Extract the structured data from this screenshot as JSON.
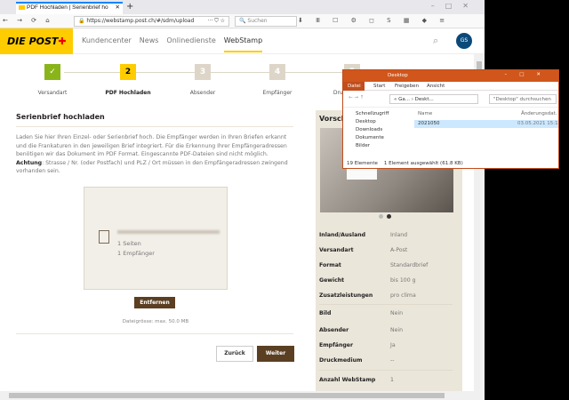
{
  "browser": {
    "tab_title": "PDF Hochladen | Serienbrief ho",
    "url": "https://webstamp.post.ch/#/sdm/upload",
    "search_placeholder": "Suchen",
    "more": "··· ⛉ ☆"
  },
  "header": {
    "logo": "DIE POST",
    "nav": [
      "Kundencenter",
      "News",
      "Onlinedienste",
      "WebStamp"
    ],
    "avatar": "GS"
  },
  "steps": [
    {
      "num": "✓",
      "label": "Versandart"
    },
    {
      "num": "2",
      "label": "PDF Hochladen"
    },
    {
      "num": "3",
      "label": "Absender"
    },
    {
      "num": "4",
      "label": "Empfänger"
    },
    {
      "num": "5",
      "label": "Druckmedium"
    },
    {
      "num": "6",
      "label": ""
    }
  ],
  "main": {
    "title": "Serienbrief hochladen",
    "desc": "Laden Sie hier Ihren Einzel- oder Serienbrief hoch. Die Empfänger werden in Ihren Briefen erkannt und die Frankaturen in den jeweiligen Brief integriert. Für die Erkennung Ihrer Empfängeradressen benötigen wir das Dokument im PDF Format. Eingescannte PDF-Dateien sind nicht möglich.",
    "warn_label": "Achtung",
    "warn_text": ": Strasse / Nr. (oder Postfach) und PLZ / Ort müssen in den Empfängeradressen zwingend vorhanden sein.",
    "pages": "1 Seiten",
    "recipients": "1 Empfänger",
    "remove": "Entfernen",
    "filesize": "Dateigrösse: max. 50.0 MB",
    "back": "Zurück",
    "next": "Weiter"
  },
  "preview": {
    "title": "Vorschau",
    "rows": [
      {
        "k": "Inland/Ausland",
        "v": "Inland"
      },
      {
        "k": "Versandart",
        "v": "A-Post"
      },
      {
        "k": "Format",
        "v": "Standardbrief"
      },
      {
        "k": "Gewicht",
        "v": "bis 100 g"
      },
      {
        "k": "Zusatzleistungen",
        "v": "pro clima"
      },
      {
        "k": "Bild",
        "v": "Nein"
      },
      {
        "k": "Absender",
        "v": "Nein"
      },
      {
        "k": "Empfänger",
        "v": "Ja"
      },
      {
        "k": "Druckmedium",
        "v": "--"
      },
      {
        "k": "Anzahl WebStamp",
        "v": "1"
      }
    ]
  },
  "explorer": {
    "title": "Desktop",
    "ribbon": [
      "Datei",
      "Start",
      "Freigeben",
      "Ansicht"
    ],
    "path": "« Ga... › Deskt...",
    "search": "\"Desktop\" durchsuchen",
    "nav": [
      "Schnellzugriff",
      "Desktop",
      "Downloads",
      "Dokumente",
      "Bilder"
    ],
    "col_name": "Name",
    "col_date": "Änderungsdat.",
    "file_name": "2021050",
    "file_date": "03.05.2021 15:1",
    "status_count": "19 Elemente",
    "status_sel": "1 Element ausgewählt (61.8 KB)"
  }
}
